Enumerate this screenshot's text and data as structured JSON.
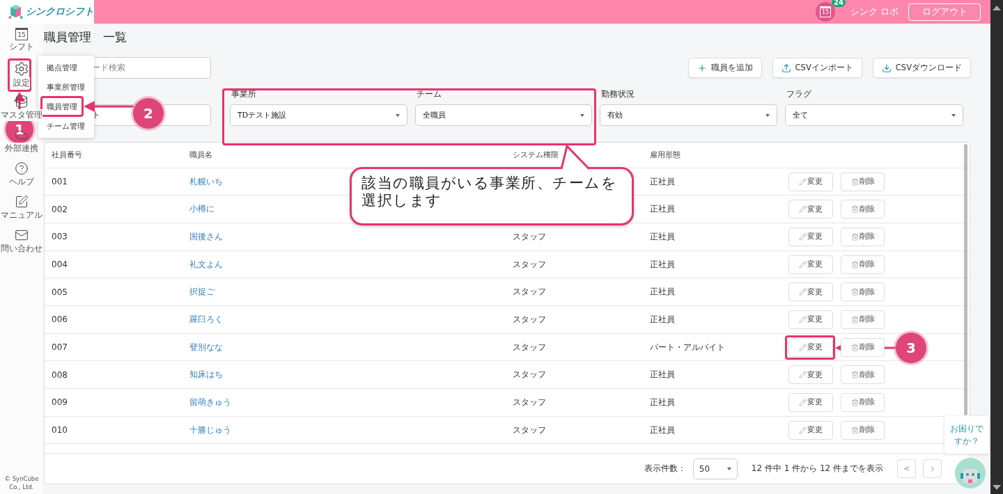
{
  "header": {
    "logo_text": "シンクロシフト",
    "calendar_day": "15",
    "notification_count": "24",
    "user_name": "シンク ロボ",
    "logout": "ログアウト"
  },
  "sidebar": {
    "items": [
      {
        "label": "シフト",
        "kind": "calendar",
        "day": "15"
      },
      {
        "label": "設定",
        "kind": "gear"
      },
      {
        "label": "マスタ管理",
        "kind": "database"
      },
      {
        "label": "外部連携",
        "kind": "cloud"
      },
      {
        "label": "ヘルプ",
        "kind": "help"
      },
      {
        "label": "マニュアル",
        "kind": "pen"
      },
      {
        "label": "問い合わせ",
        "kind": "mail"
      }
    ],
    "copyright": "© SynCube Co., Ltd."
  },
  "page_title": "職員管理　一覧",
  "settings_menu": [
    "拠点管理",
    "事業所管理",
    "職員管理",
    "チーム管理"
  ],
  "search": {
    "placeholder": "ード検索"
  },
  "actions": [
    {
      "label": "職員を追加",
      "kind": "add"
    },
    {
      "label": "CSVインポート",
      "kind": "upload"
    },
    {
      "label": "CSVダウンロード",
      "kind": "download"
    }
  ],
  "filters": [
    {
      "value": "ト"
    },
    {
      "label": "事業所",
      "value": "TDテスト施設"
    },
    {
      "label": "チーム",
      "value": "全職員"
    },
    {
      "label": "勤務状況",
      "value": "有効"
    },
    {
      "label": "フラグ",
      "value": "全て"
    }
  ],
  "table": {
    "columns": [
      "社員番号",
      "職員名",
      "システム権限",
      "雇用形態"
    ],
    "rows": [
      {
        "id": "001",
        "name": "札幌いち",
        "employment": "正社員",
        "edit": "変更",
        "delete": "削除"
      },
      {
        "id": "002",
        "name": "小樽に",
        "employment": "正社員",
        "edit": "変更",
        "delete": "削除"
      },
      {
        "id": "003",
        "name": "国後さん",
        "system": "スタッフ",
        "employment": "正社員",
        "edit": "変更",
        "delete": "削除"
      },
      {
        "id": "004",
        "name": "礼文よん",
        "system": "スタッフ",
        "employment": "正社員",
        "edit": "変更",
        "delete": "削除"
      },
      {
        "id": "005",
        "name": "択捉ご",
        "system": "スタッフ",
        "employment": "正社員",
        "edit": "変更",
        "delete": "削除"
      },
      {
        "id": "006",
        "name": "羅臼ろく",
        "system": "スタッフ",
        "employment": "正社員",
        "edit": "変更",
        "delete": "削除"
      },
      {
        "id": "007",
        "name": "登別なな",
        "system": "スタッフ",
        "employment": "パート・アルバイト",
        "edit": "変更",
        "delete": "削除"
      },
      {
        "id": "008",
        "name": "知床はち",
        "system": "スタッフ",
        "employment": "正社員",
        "edit": "変更",
        "delete": "削除"
      },
      {
        "id": "009",
        "name": "留萌きゅう",
        "system": "スタッフ",
        "employment": "正社員",
        "edit": "変更",
        "delete": "削除"
      },
      {
        "id": "010",
        "name": "十勝じゅう",
        "system": "スタッフ",
        "employment": "正社員",
        "edit": "変更",
        "delete": "削除"
      }
    ]
  },
  "pagination": {
    "page_size_label": "表示件数：",
    "page_size": "50",
    "summary": "12 件中 1 件から 12 件までを表示",
    "prev": "<"
  },
  "help_bubble": "お困りですか？",
  "annotations": [
    {
      "kind": "frame"
    },
    {
      "kind": "marker",
      "label": "1"
    },
    {
      "kind": "frame"
    },
    {
      "kind": "marker",
      "label": "2"
    },
    {
      "kind": "frame"
    },
    {
      "kind": "callout",
      "text": "該当の職員がいる事業所、チームを選択します"
    },
    {
      "kind": "frame"
    },
    {
      "kind": "marker",
      "label": "3"
    }
  ]
}
